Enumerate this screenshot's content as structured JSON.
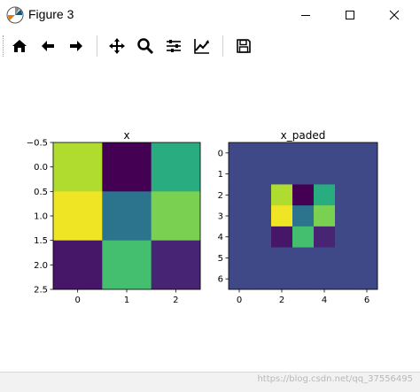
{
  "window": {
    "title": "Figure 3"
  },
  "toolbar": {
    "tools": [
      {
        "name": "home-icon"
      },
      {
        "name": "back-arrow-icon"
      },
      {
        "name": "forward-arrow-icon"
      },
      {
        "name": "pan-icon"
      },
      {
        "name": "zoom-icon"
      },
      {
        "name": "subplots-config-icon"
      },
      {
        "name": "edit-axes-icon"
      },
      {
        "name": "save-icon"
      }
    ]
  },
  "chart_data": [
    {
      "type": "heatmap",
      "title": "x",
      "colormap": "viridis",
      "xticks": [
        "0",
        "1",
        "2"
      ],
      "yticks": [
        "−0.5",
        "0.0",
        "0.5",
        "1.0",
        "1.5",
        "2.0",
        "2.5"
      ],
      "xlim": [
        -0.5,
        2.5
      ],
      "ylim": [
        2.5,
        -0.5
      ],
      "values": [
        [
          0.88,
          0.0,
          0.62
        ],
        [
          0.98,
          0.38,
          0.8
        ],
        [
          0.06,
          0.7,
          0.1
        ]
      ]
    },
    {
      "type": "heatmap",
      "title": "x_paded",
      "colormap": "viridis",
      "xticks": [
        "0",
        "2",
        "4",
        "6"
      ],
      "yticks": [
        "0",
        "1",
        "2",
        "3",
        "4",
        "5",
        "6"
      ],
      "xlim": [
        -0.5,
        6.5
      ],
      "ylim": [
        6.5,
        -0.5
      ],
      "pad_value": 0.22,
      "values": [
        [
          0.22,
          0.22,
          0.22,
          0.22,
          0.22,
          0.22,
          0.22
        ],
        [
          0.22,
          0.22,
          0.22,
          0.22,
          0.22,
          0.22,
          0.22
        ],
        [
          0.22,
          0.22,
          0.88,
          0.0,
          0.62,
          0.22,
          0.22
        ],
        [
          0.22,
          0.22,
          0.98,
          0.38,
          0.8,
          0.22,
          0.22
        ],
        [
          0.22,
          0.22,
          0.06,
          0.7,
          0.1,
          0.22,
          0.22
        ],
        [
          0.22,
          0.22,
          0.22,
          0.22,
          0.22,
          0.22,
          0.22
        ],
        [
          0.22,
          0.22,
          0.22,
          0.22,
          0.22,
          0.22,
          0.22
        ]
      ]
    }
  ],
  "statusbar": {
    "watermark": "https://blog.csdn.net/qq_37556495"
  }
}
